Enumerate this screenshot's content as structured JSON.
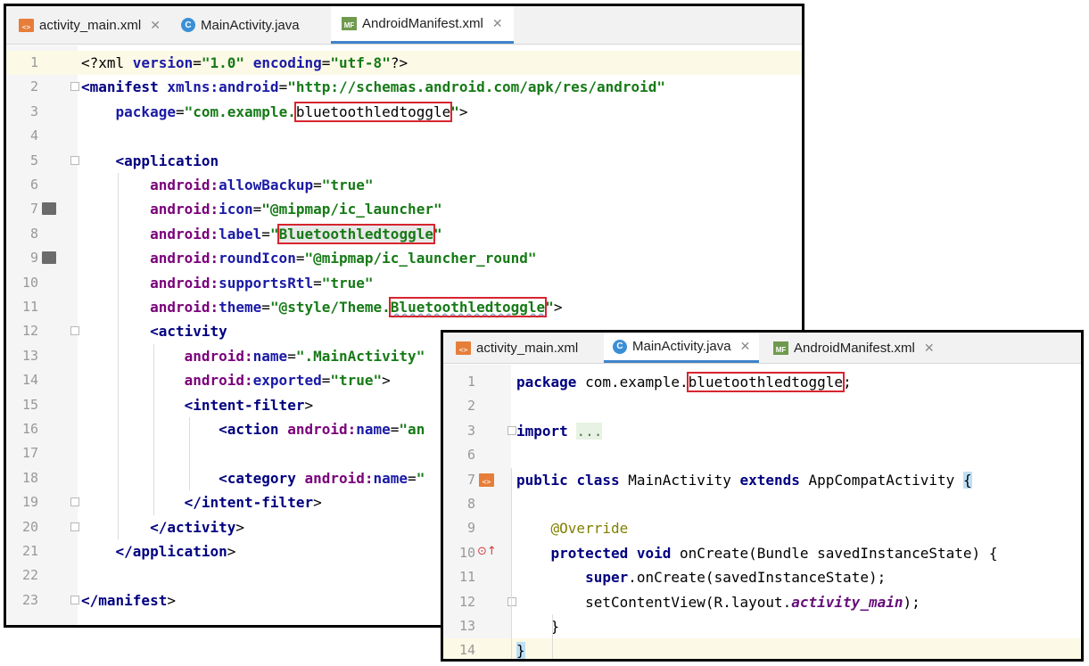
{
  "window_manifest": {
    "tabs": [
      {
        "label": "activity_main.xml",
        "icon": "xml-file-icon",
        "active": false
      },
      {
        "label": "MainActivity.java",
        "icon": "java-class-icon",
        "active": false
      },
      {
        "label": "AndroidManifest.xml",
        "icon": "manifest-file-icon",
        "active": true
      }
    ],
    "lines": [
      {
        "n": "1",
        "parts": [
          [
            "plain",
            "<?xml "
          ],
          [
            "attrb",
            "version"
          ],
          [
            "plain",
            "="
          ],
          [
            "val",
            "\"1.0\""
          ],
          [
            "plain",
            " "
          ],
          [
            "attrb",
            "encoding"
          ],
          [
            "plain",
            "="
          ],
          [
            "val",
            "\"utf-8\""
          ],
          [
            "plain",
            "?>"
          ]
        ]
      },
      {
        "n": "2",
        "parts": [
          [
            "tag",
            "<manifest "
          ],
          [
            "attrb",
            "xmlns:android"
          ],
          [
            "plain",
            "="
          ],
          [
            "val",
            "\"http://schemas.android.com/apk/res/android\""
          ]
        ]
      },
      {
        "n": "3",
        "parts": [
          [
            "plain",
            "    "
          ],
          [
            "attrb",
            "package"
          ],
          [
            "plain",
            "="
          ],
          [
            "val",
            "\"com.example."
          ],
          [
            "hl",
            "bluetoothledtoggle"
          ],
          [
            "val",
            "\""
          ],
          [
            "plain",
            ">"
          ]
        ]
      },
      {
        "n": "4",
        "parts": []
      },
      {
        "n": "5",
        "parts": [
          [
            "plain",
            "    "
          ],
          [
            "tag",
            "<application"
          ]
        ]
      },
      {
        "n": "6",
        "parts": [
          [
            "plain",
            "        "
          ],
          [
            "attr",
            "android:"
          ],
          [
            "attrb",
            "allowBackup"
          ],
          [
            "plain",
            "="
          ],
          [
            "val",
            "\"true\""
          ]
        ]
      },
      {
        "n": "7",
        "parts": [
          [
            "plain",
            "        "
          ],
          [
            "attr",
            "android:"
          ],
          [
            "attrb",
            "icon"
          ],
          [
            "plain",
            "="
          ],
          [
            "val",
            "\"@mipmap/ic_launcher\""
          ]
        ]
      },
      {
        "n": "8",
        "parts": [
          [
            "plain",
            "        "
          ],
          [
            "attr",
            "android:"
          ],
          [
            "attrb",
            "label"
          ],
          [
            "plain",
            "="
          ],
          [
            "val",
            "\""
          ],
          [
            "hlgrey",
            "Bluetoothledtoggle"
          ],
          [
            "val",
            "\""
          ]
        ]
      },
      {
        "n": "9",
        "parts": [
          [
            "plain",
            "        "
          ],
          [
            "attr",
            "android:"
          ],
          [
            "attrb",
            "roundIcon"
          ],
          [
            "plain",
            "="
          ],
          [
            "val",
            "\"@mipmap/ic_launcher_round\""
          ]
        ]
      },
      {
        "n": "10",
        "parts": [
          [
            "plain",
            "        "
          ],
          [
            "attr",
            "android:"
          ],
          [
            "attrb",
            "supportsRtl"
          ],
          [
            "plain",
            "="
          ],
          [
            "val",
            "\"true\""
          ]
        ]
      },
      {
        "n": "11",
        "parts": [
          [
            "plain",
            "        "
          ],
          [
            "attr",
            "android:"
          ],
          [
            "attrb",
            "theme"
          ],
          [
            "plain",
            "="
          ],
          [
            "val",
            "\"@style/Theme."
          ],
          [
            "hlwavy",
            "Bluetoothledtoggle"
          ],
          [
            "val",
            "\""
          ],
          [
            "plain",
            ">"
          ]
        ]
      },
      {
        "n": "12",
        "parts": [
          [
            "plain",
            "        "
          ],
          [
            "tag",
            "<activity"
          ]
        ]
      },
      {
        "n": "13",
        "parts": [
          [
            "plain",
            "            "
          ],
          [
            "attr",
            "android:"
          ],
          [
            "attrb",
            "name"
          ],
          [
            "plain",
            "="
          ],
          [
            "val",
            "\".MainActivity\""
          ]
        ]
      },
      {
        "n": "14",
        "parts": [
          [
            "plain",
            "            "
          ],
          [
            "attr",
            "android:"
          ],
          [
            "attrb",
            "exported"
          ],
          [
            "plain",
            "="
          ],
          [
            "val",
            "\"true\""
          ],
          [
            "plain",
            ">"
          ]
        ]
      },
      {
        "n": "15",
        "parts": [
          [
            "plain",
            "            "
          ],
          [
            "tag",
            "<intent-filter"
          ],
          [
            "plain",
            ">"
          ]
        ]
      },
      {
        "n": "16",
        "parts": [
          [
            "plain",
            "                "
          ],
          [
            "tag",
            "<action "
          ],
          [
            "attr",
            "android:"
          ],
          [
            "attrb",
            "name"
          ],
          [
            "plain",
            "="
          ],
          [
            "val",
            "\"an"
          ]
        ]
      },
      {
        "n": "17",
        "parts": []
      },
      {
        "n": "18",
        "parts": [
          [
            "plain",
            "                "
          ],
          [
            "tag",
            "<category "
          ],
          [
            "attr",
            "android:"
          ],
          [
            "attrb",
            "name"
          ],
          [
            "plain",
            "="
          ],
          [
            "val",
            "\""
          ]
        ]
      },
      {
        "n": "19",
        "parts": [
          [
            "plain",
            "            "
          ],
          [
            "tag",
            "</intent-filter"
          ],
          [
            "plain",
            ">"
          ]
        ]
      },
      {
        "n": "20",
        "parts": [
          [
            "plain",
            "        "
          ],
          [
            "tag",
            "</activity"
          ],
          [
            "plain",
            ">"
          ]
        ]
      },
      {
        "n": "21",
        "parts": [
          [
            "plain",
            "    "
          ],
          [
            "tag",
            "</application"
          ],
          [
            "plain",
            ">"
          ]
        ]
      },
      {
        "n": "22",
        "parts": []
      },
      {
        "n": "23",
        "parts": [
          [
            "tag",
            "</manifest"
          ],
          [
            "plain",
            ">"
          ]
        ]
      }
    ]
  },
  "window_java": {
    "tabs": [
      {
        "label": "activity_main.xml",
        "icon": "xml-file-icon",
        "active": false
      },
      {
        "label": "MainActivity.java",
        "icon": "java-class-icon",
        "active": true
      },
      {
        "label": "AndroidManifest.xml",
        "icon": "manifest-file-icon",
        "active": false
      }
    ],
    "lines": [
      {
        "n": "1",
        "parts": [
          [
            "kwp",
            "package"
          ],
          [
            "plain",
            " com.example."
          ],
          [
            "hl",
            "bluetoothledtoggle"
          ],
          [
            "plain",
            ";"
          ]
        ]
      },
      {
        "n": "2",
        "parts": []
      },
      {
        "n": "3",
        "parts": [
          [
            "kw",
            "import"
          ],
          [
            "plain",
            " "
          ],
          [
            "fold",
            "..."
          ]
        ]
      },
      {
        "n": "6",
        "parts": []
      },
      {
        "n": "7",
        "parts": [
          [
            "kw",
            "public"
          ],
          [
            "plain",
            " "
          ],
          [
            "kw",
            "class"
          ],
          [
            "plain",
            " MainActivity "
          ],
          [
            "kw",
            "extends"
          ],
          [
            "plain",
            " AppCompatActivity "
          ],
          [
            "brace",
            "{"
          ]
        ]
      },
      {
        "n": "8",
        "parts": []
      },
      {
        "n": "9",
        "parts": [
          [
            "plain",
            "    "
          ],
          [
            "ann",
            "@Override"
          ]
        ]
      },
      {
        "n": "10",
        "parts": [
          [
            "plain",
            "    "
          ],
          [
            "kw",
            "protected"
          ],
          [
            "plain",
            " "
          ],
          [
            "kw",
            "void"
          ],
          [
            "plain",
            " onCreate(Bundle savedInstanceState) {"
          ]
        ]
      },
      {
        "n": "11",
        "parts": [
          [
            "plain",
            "        "
          ],
          [
            "kw",
            "super"
          ],
          [
            "plain",
            ".onCreate(savedInstanceState);"
          ]
        ]
      },
      {
        "n": "12",
        "parts": [
          [
            "plain",
            "        setContentView(R.layout."
          ],
          [
            "it",
            "activity_main"
          ],
          [
            "plain",
            ");"
          ]
        ]
      },
      {
        "n": "13",
        "parts": [
          [
            "plain",
            "    }"
          ]
        ]
      },
      {
        "n": "14",
        "parts": [
          [
            "brace",
            "}"
          ]
        ]
      }
    ]
  }
}
